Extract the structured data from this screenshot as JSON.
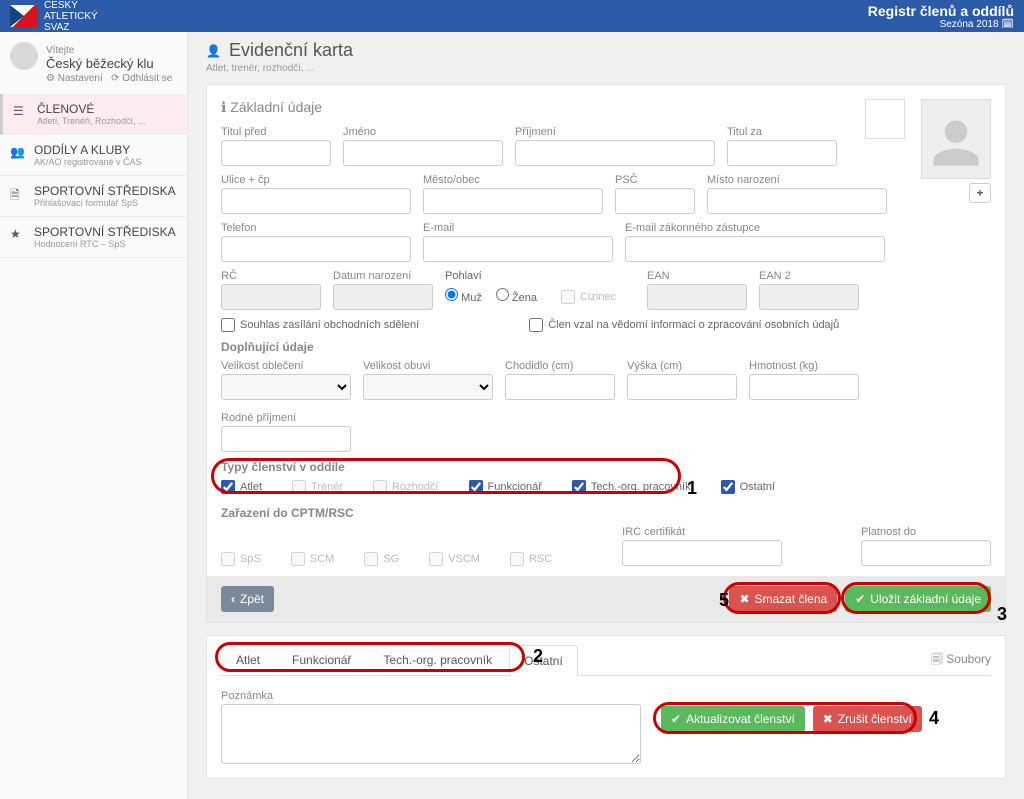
{
  "topbar": {
    "org1": "ČESKÝ",
    "org2": "ATLETICKÝ",
    "org3": "SVAZ",
    "title": "Registr členů a oddílů",
    "season": "Sezóna 2018 🗓"
  },
  "user": {
    "welcome": "Vítejte",
    "club": "Český běžecký klu",
    "settings": "Nastavení",
    "logout": "Odhlásit se"
  },
  "nav": {
    "members_t": "ČLENOVÉ",
    "members_s": "Atleti, Trenéři, Rozhodčí, ...",
    "clubs_t": "ODDÍLY A KLUBY",
    "clubs_s": "AK/AO registrované v ČAS",
    "centers1_t": "SPORTOVNÍ STŘEDISKA",
    "centers1_s": "Přihlašovací formulář SpS",
    "centers2_t": "SPORTOVNÍ STŘEDISKA",
    "centers2_s": "Hodnocení RTC – SpS"
  },
  "page": {
    "title": "Evidenční karta",
    "subtitle": "Atlet, trenér, rozhodčí, ..."
  },
  "basic": {
    "heading": "Základní údaje",
    "title_before": "Titul před",
    "firstname": "Jméno",
    "surname": "Příjmení",
    "title_after": "Titul za",
    "street": "Ulice + čp",
    "city": "Město/obec",
    "zip": "PSČ",
    "birthplace": "Místo narození",
    "phone": "Telefon",
    "email": "E-mail",
    "guardian_email": "E-mail zákonného zástupce",
    "rc": "RČ",
    "birthdate": "Datum narození",
    "sex": "Pohlaví",
    "sex_m": "Muž",
    "sex_f": "Žena",
    "foreigner": "Cizinec",
    "ean": "EAN",
    "ean2": "EAN 2",
    "consent_marketing": "Souhlas zasílání obchodních sdělení",
    "consent_gdpr": "Člen vzal na vědomí informaci o zpracování osobních údajů"
  },
  "extra": {
    "heading": "Doplňující údaje",
    "cloth": "Velikost oblečení",
    "shoe": "Velikost obuvi",
    "foot": "Chodidlo (cm)",
    "height": "Výška (cm)",
    "weight": "Hmotnost (kg)",
    "maiden": "Rodné příjmení"
  },
  "types": {
    "heading": "Typy členství v oddíle",
    "athlete": "Atlet",
    "coach": "Trenér",
    "referee": "Rozhodčí",
    "official": "Funkcionář",
    "tech": "Tech.-org. pracovník",
    "other": "Ostatní"
  },
  "cptm": {
    "heading": "Zařazení do CPTM/RSC",
    "sps": "SpS",
    "scm": "SCM",
    "sg": "SG",
    "vscm": "VSCM",
    "rsc": "RSC",
    "irc": "IRC certifikát",
    "valid": "Platnost do"
  },
  "actions": {
    "back": "Zpět",
    "delete": "Smazat člena",
    "save": "Uložit základní údaje"
  },
  "tabs": {
    "athlete": "Atlet",
    "official": "Funkcionář",
    "tech": "Tech.-org. pracovník",
    "other": "Ostatní",
    "files": "Soubory"
  },
  "note": {
    "label": "Poznámka",
    "update": "Aktualizovat členství",
    "cancel": "Zrušit členství"
  },
  "annotations": {
    "n1": "1",
    "n2": "2",
    "n3": "3",
    "n4": "4",
    "n5": "5"
  }
}
